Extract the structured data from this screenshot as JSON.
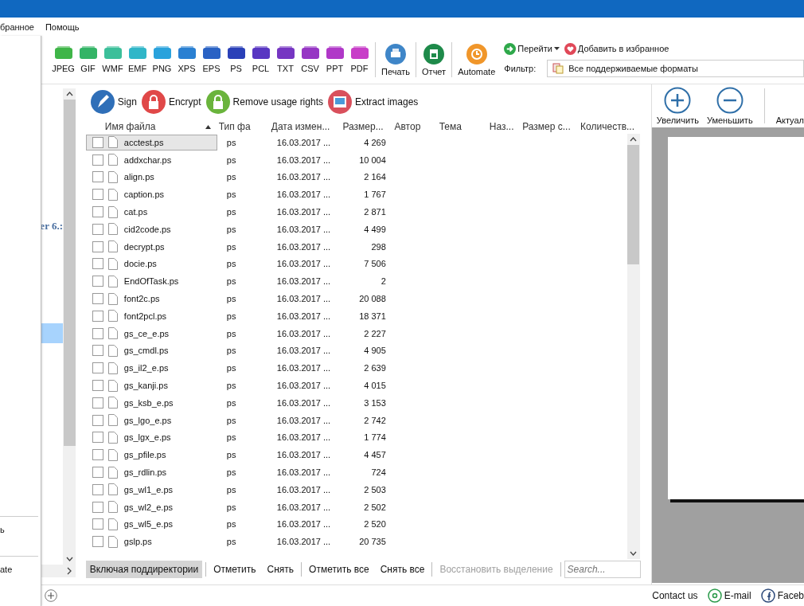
{
  "menu": {
    "items": [
      "бранное",
      "Помощь"
    ]
  },
  "dropdown": {
    "items": [
      "ь",
      "ate"
    ]
  },
  "formats": [
    {
      "label": "JPEG",
      "color": "#3fb548"
    },
    {
      "label": "GIF",
      "color": "#33b466"
    },
    {
      "label": "WMF",
      "color": "#3cbf9a"
    },
    {
      "label": "EMF",
      "color": "#30b6c8"
    },
    {
      "label": "PNG",
      "color": "#2aa2dc"
    },
    {
      "label": "XPS",
      "color": "#2a80d2"
    },
    {
      "label": "EPS",
      "color": "#2a62c4"
    },
    {
      "label": "PS",
      "color": "#2a40b8"
    },
    {
      "label": "PCL",
      "color": "#5836c2"
    },
    {
      "label": "TXT",
      "color": "#7636c2"
    },
    {
      "label": "CSV",
      "color": "#9636c4"
    },
    {
      "label": "PPT",
      "color": "#b038c8"
    },
    {
      "label": "PDF",
      "color": "#c83ec8"
    }
  ],
  "tools": [
    {
      "label": "Печать",
      "kind": "print"
    },
    {
      "label": "Отчет",
      "kind": "report"
    },
    {
      "label": "Automate",
      "kind": "automate"
    }
  ],
  "nav": {
    "goto": "Перейти",
    "favorite": "Добавить в избранное"
  },
  "filter": {
    "label": "Фильтр:",
    "value": "Все поддерживаемые форматы"
  },
  "tree": {
    "label": "er 6.:"
  },
  "actions": [
    {
      "label": "Sign",
      "kind": "sign"
    },
    {
      "label": "Encrypt",
      "kind": "encrypt"
    },
    {
      "label": "Remove usage rights",
      "kind": "unlock"
    },
    {
      "label": "Extract images",
      "kind": "images"
    }
  ],
  "table": {
    "columns": [
      {
        "label": "Имя файла",
        "sorted": true
      },
      {
        "label": "Тип фа",
        "sorted": false
      },
      {
        "label": "Дата измен...",
        "sorted": false
      },
      {
        "label": "Размер...",
        "sorted": false
      },
      {
        "label": "Автор",
        "sorted": false
      },
      {
        "label": "Тема",
        "sorted": false
      },
      {
        "label": "Наз...",
        "sorted": false
      },
      {
        "label": "Размер с...",
        "sorted": false
      },
      {
        "label": "Количеств...",
        "sorted": false
      }
    ],
    "rows": [
      {
        "name": "acctest.ps",
        "type": "ps",
        "date": "16.03.2017 ...",
        "size": "4 269",
        "checked": false,
        "selected": true
      },
      {
        "name": "addxchar.ps",
        "type": "ps",
        "date": "16.03.2017 ...",
        "size": "10 004",
        "checked": false,
        "selected": false
      },
      {
        "name": "align.ps",
        "type": "ps",
        "date": "16.03.2017 ...",
        "size": "2 164",
        "checked": false,
        "selected": false
      },
      {
        "name": "caption.ps",
        "type": "ps",
        "date": "16.03.2017 ...",
        "size": "1 767",
        "checked": false,
        "selected": false
      },
      {
        "name": "cat.ps",
        "type": "ps",
        "date": "16.03.2017 ...",
        "size": "2 871",
        "checked": false,
        "selected": false
      },
      {
        "name": "cid2code.ps",
        "type": "ps",
        "date": "16.03.2017 ...",
        "size": "4 499",
        "checked": false,
        "selected": false
      },
      {
        "name": "decrypt.ps",
        "type": "ps",
        "date": "16.03.2017 ...",
        "size": "298",
        "checked": false,
        "selected": false
      },
      {
        "name": "docie.ps",
        "type": "ps",
        "date": "16.03.2017 ...",
        "size": "7 506",
        "checked": false,
        "selected": false
      },
      {
        "name": "EndOfTask.ps",
        "type": "ps",
        "date": "16.03.2017 ...",
        "size": "2",
        "checked": false,
        "selected": false
      },
      {
        "name": "font2c.ps",
        "type": "ps",
        "date": "16.03.2017 ...",
        "size": "20 088",
        "checked": false,
        "selected": false
      },
      {
        "name": "font2pcl.ps",
        "type": "ps",
        "date": "16.03.2017 ...",
        "size": "18 371",
        "checked": false,
        "selected": false
      },
      {
        "name": "gs_ce_e.ps",
        "type": "ps",
        "date": "16.03.2017 ...",
        "size": "2 227",
        "checked": false,
        "selected": false
      },
      {
        "name": "gs_cmdl.ps",
        "type": "ps",
        "date": "16.03.2017 ...",
        "size": "4 905",
        "checked": false,
        "selected": false
      },
      {
        "name": "gs_il2_e.ps",
        "type": "ps",
        "date": "16.03.2017 ...",
        "size": "2 639",
        "checked": false,
        "selected": false
      },
      {
        "name": "gs_kanji.ps",
        "type": "ps",
        "date": "16.03.2017 ...",
        "size": "4 015",
        "checked": false,
        "selected": false
      },
      {
        "name": "gs_ksb_e.ps",
        "type": "ps",
        "date": "16.03.2017 ...",
        "size": "3 153",
        "checked": false,
        "selected": false
      },
      {
        "name": "gs_lgo_e.ps",
        "type": "ps",
        "date": "16.03.2017 ...",
        "size": "2 742",
        "checked": false,
        "selected": false
      },
      {
        "name": "gs_lgx_e.ps",
        "type": "ps",
        "date": "16.03.2017 ...",
        "size": "1 774",
        "checked": false,
        "selected": false
      },
      {
        "name": "gs_pfile.ps",
        "type": "ps",
        "date": "16.03.2017 ...",
        "size": "4 457",
        "checked": false,
        "selected": false
      },
      {
        "name": "gs_rdlin.ps",
        "type": "ps",
        "date": "16.03.2017 ...",
        "size": "724",
        "checked": false,
        "selected": false
      },
      {
        "name": "gs_wl1_e.ps",
        "type": "ps",
        "date": "16.03.2017 ...",
        "size": "2 503",
        "checked": false,
        "selected": false
      },
      {
        "name": "gs_wl2_e.ps",
        "type": "ps",
        "date": "16.03.2017 ...",
        "size": "2 502",
        "checked": false,
        "selected": false
      },
      {
        "name": "gs_wl5_e.ps",
        "type": "ps",
        "date": "16.03.2017 ...",
        "size": "2 520",
        "checked": false,
        "selected": false
      },
      {
        "name": "gslp.ps",
        "type": "ps",
        "date": "16.03.2017 ...",
        "size": "20 735",
        "checked": false,
        "selected": false
      }
    ]
  },
  "bottom_bar": {
    "buttons": [
      {
        "label": "Включая поддиректории",
        "selected": true,
        "disabled": false
      },
      {
        "label": "Отметить",
        "selected": false,
        "disabled": false
      },
      {
        "label": "Снять",
        "selected": false,
        "disabled": false
      },
      {
        "label": "Отметить все",
        "selected": false,
        "disabled": false
      },
      {
        "label": "Снять все",
        "selected": false,
        "disabled": false
      },
      {
        "label": "Восстановить выделение",
        "selected": false,
        "disabled": true
      }
    ],
    "search": {
      "placeholder": "Search..."
    }
  },
  "preview": {
    "tools": [
      {
        "label": "Увеличить",
        "kind": "plus"
      },
      {
        "label": "Уменьшить",
        "kind": "minus"
      },
      {
        "label": "Актуал",
        "kind": "none"
      }
    ]
  },
  "status_bar": {
    "contact": "Contact us",
    "email": "E-mail",
    "facebook": "Faceb"
  }
}
